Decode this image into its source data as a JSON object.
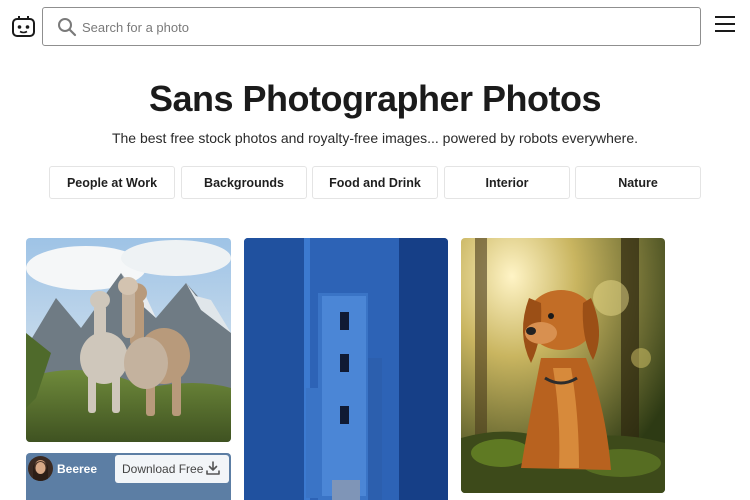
{
  "header": {
    "logo_icon": "robot-face-icon",
    "search": {
      "placeholder": "Search for a photo",
      "icon": "search-icon"
    },
    "menu_icon": "hamburger-menu-icon"
  },
  "hero": {
    "title": "Sans Photographer Photos",
    "subtitle": "The best free stock photos and royalty-free images... powered by robots everywhere."
  },
  "categories": [
    {
      "label": "People at Work"
    },
    {
      "label": "Backgrounds"
    },
    {
      "label": "Food and Drink"
    },
    {
      "label": "Interior"
    },
    {
      "label": "Nature"
    }
  ],
  "photos": [
    {
      "subject": "llamas-in-mountains"
    },
    {
      "subject": "blue-building"
    },
    {
      "subject": "golden-retriever-in-forest"
    }
  ],
  "author_card": {
    "name": "Beeree",
    "download_label": "Download Free",
    "download_icon": "download-icon"
  },
  "colors": {
    "border": "#e4e4e4",
    "text": "#1f1f1f",
    "blue_building": "#2d63b6"
  }
}
